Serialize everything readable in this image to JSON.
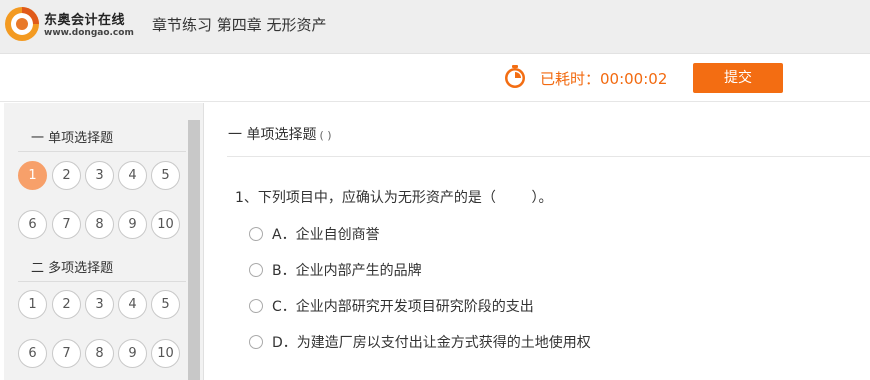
{
  "header": {
    "logo_cn": "东奥会计在线",
    "logo_en": "www.dongao.com",
    "page_title": "章节练习 第四章 无形资产"
  },
  "timer": {
    "label": "已耗时：00:00:02",
    "submit_label": "提交"
  },
  "sidebar": {
    "sections": [
      {
        "title": "一 单项选择题",
        "numbers": [
          "1",
          "2",
          "3",
          "4",
          "5",
          "6",
          "7",
          "8",
          "9",
          "10"
        ],
        "active": "1"
      },
      {
        "title": "二 多项选择题",
        "numbers": [
          "1",
          "2",
          "3",
          "4",
          "5",
          "6",
          "7",
          "8",
          "9",
          "10"
        ]
      }
    ]
  },
  "main": {
    "section_title": "一 单项选择题",
    "section_paren": "( )",
    "question": "1、下列项目中，应确认为无形资产的是（        ）。",
    "options": [
      "A．企业自创商誉",
      "B．企业内部产生的品牌",
      "C．企业内部研究开发项目研究阶段的支出",
      "D．为建造厂房以支付出让金方式获得的土地使用权"
    ]
  },
  "colors": {
    "accent": "#f36d12",
    "timer_text": "#f26a10",
    "active_number": "#f7a06a"
  }
}
